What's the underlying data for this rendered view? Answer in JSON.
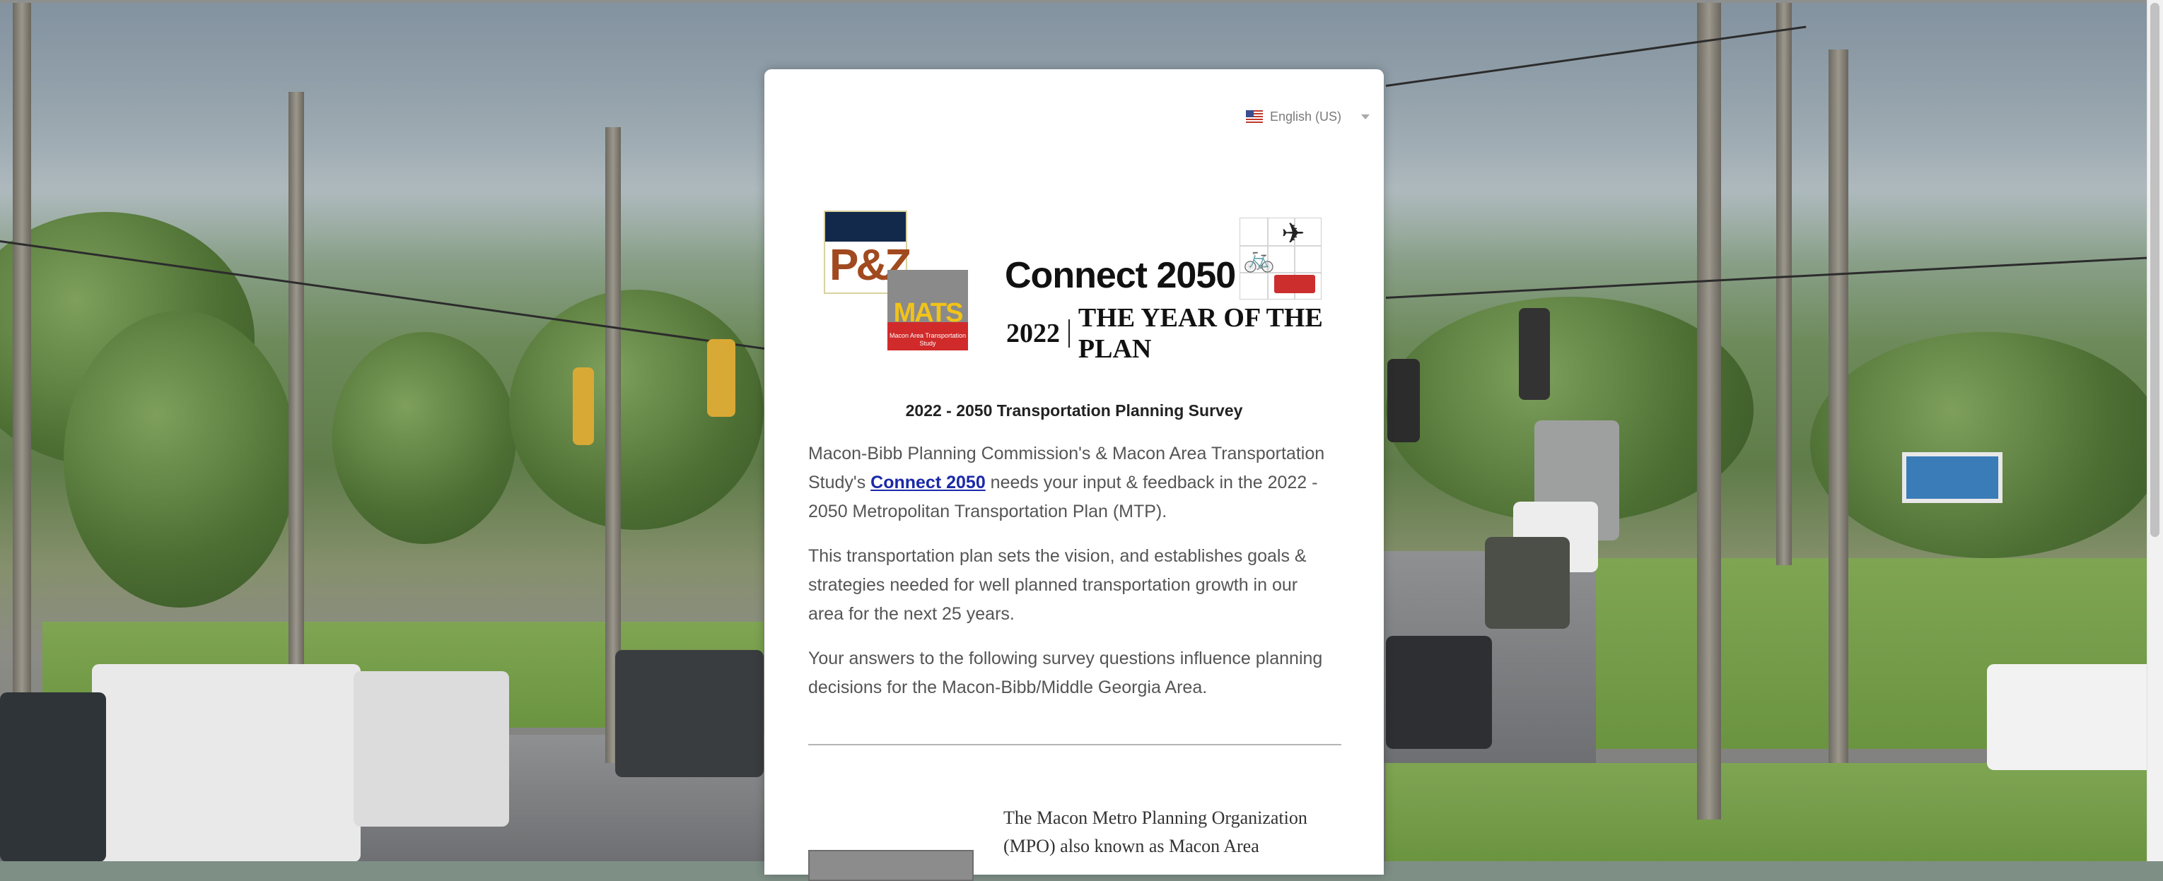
{
  "language_selector": {
    "flag_icon": "us-flag-icon",
    "label": "English (US)"
  },
  "logos": {
    "pz": {
      "text": "P&Z"
    },
    "mats": {
      "text": "MATS",
      "subtitle": "Macon Area Transportation Study"
    },
    "connect": {
      "title": "Connect 2050",
      "subtitle_year": "2022",
      "subtitle_text": "THE YEAR OF THE PLAN"
    }
  },
  "survey": {
    "title": "2022 - 2050 Transportation Planning Survey",
    "paragraph1_before": "Macon-Bibb Planning Commission's & Macon Area Transportation Study's ",
    "paragraph1_link": "Connect 2050",
    "paragraph1_after": " needs your input & feedback in the 2022 - 2050 Metropolitan Transportation Plan (MTP).",
    "paragraph2": "This transportation plan sets the vision, and establishes goals & strategies needed for well planned transportation growth in our area for the next 25 years.",
    "paragraph3": "Your answers to the following survey questions influence planning decisions for the Macon-Bibb/Middle Georgia Area.",
    "mpo_text": "The Macon Metro Planning Organization (MPO) also known as Macon Area"
  },
  "colors": {
    "link": "#1a29a8",
    "pz_navy": "#13294b",
    "mats_red": "#d02a2a",
    "mats_yellow": "#f2c318"
  }
}
